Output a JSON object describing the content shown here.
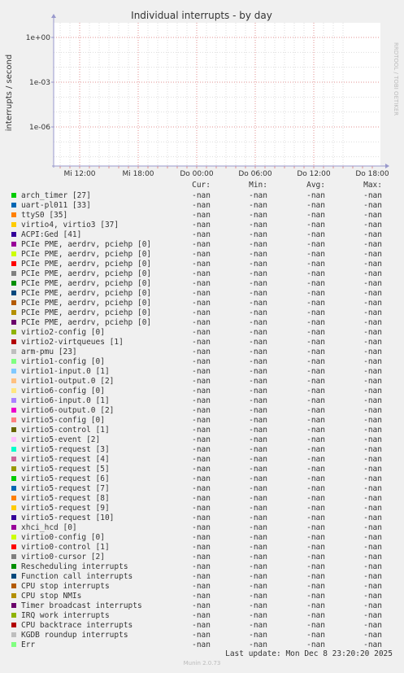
{
  "chart_data": {
    "type": "line",
    "title": "Individual interrupts - by day",
    "ylabel": "interrupts / second",
    "xlabel": "",
    "y_scale": "log",
    "y_ticks": [
      "1e+00",
      "1e-03",
      "1e-06"
    ],
    "x_ticks": [
      "Mi 12:00",
      "Mi 18:00",
      "Do 00:00",
      "Do 06:00",
      "Do 12:00",
      "Do 18:00"
    ],
    "watermark": "RRDTOOL / TOBI OETIKER",
    "grid": true,
    "columns": [
      "Cur:",
      "Min:",
      "Avg:",
      "Max:"
    ],
    "series": [
      {
        "name": "arch_timer [27]",
        "color": "#00cc00",
        "cur": "-nan",
        "min": "-nan",
        "avg": "-nan",
        "max": "-nan"
      },
      {
        "name": "uart-pl011 [33]",
        "color": "#0066b3",
        "cur": "-nan",
        "min": "-nan",
        "avg": "-nan",
        "max": "-nan"
      },
      {
        "name": "ttyS0 [35]",
        "color": "#ff8000",
        "cur": "-nan",
        "min": "-nan",
        "avg": "-nan",
        "max": "-nan"
      },
      {
        "name": "virtio4, virtio3 [37]",
        "color": "#ffcc00",
        "cur": "-nan",
        "min": "-nan",
        "avg": "-nan",
        "max": "-nan"
      },
      {
        "name": "ACPI:Ged [41]",
        "color": "#330099",
        "cur": "-nan",
        "min": "-nan",
        "avg": "-nan",
        "max": "-nan"
      },
      {
        "name": "PCIe PME, aerdrv, pciehp [0]",
        "color": "#990099",
        "cur": "-nan",
        "min": "-nan",
        "avg": "-nan",
        "max": "-nan"
      },
      {
        "name": "PCIe PME, aerdrv, pciehp [0]",
        "color": "#ccff00",
        "cur": "-nan",
        "min": "-nan",
        "avg": "-nan",
        "max": "-nan"
      },
      {
        "name": "PCIe PME, aerdrv, pciehp [0]",
        "color": "#ff0000",
        "cur": "-nan",
        "min": "-nan",
        "avg": "-nan",
        "max": "-nan"
      },
      {
        "name": "PCIe PME, aerdrv, pciehp [0]",
        "color": "#808080",
        "cur": "-nan",
        "min": "-nan",
        "avg": "-nan",
        "max": "-nan"
      },
      {
        "name": "PCIe PME, aerdrv, pciehp [0]",
        "color": "#008f00",
        "cur": "-nan",
        "min": "-nan",
        "avg": "-nan",
        "max": "-nan"
      },
      {
        "name": "PCIe PME, aerdrv, pciehp [0]",
        "color": "#00487d",
        "cur": "-nan",
        "min": "-nan",
        "avg": "-nan",
        "max": "-nan"
      },
      {
        "name": "PCIe PME, aerdrv, pciehp [0]",
        "color": "#b35a00",
        "cur": "-nan",
        "min": "-nan",
        "avg": "-nan",
        "max": "-nan"
      },
      {
        "name": "PCIe PME, aerdrv, pciehp [0]",
        "color": "#b38f00",
        "cur": "-nan",
        "min": "-nan",
        "avg": "-nan",
        "max": "-nan"
      },
      {
        "name": "PCIe PME, aerdrv, pciehp [0]",
        "color": "#6b006b",
        "cur": "-nan",
        "min": "-nan",
        "avg": "-nan",
        "max": "-nan"
      },
      {
        "name": "virtio2-config [0]",
        "color": "#8fb300",
        "cur": "-nan",
        "min": "-nan",
        "avg": "-nan",
        "max": "-nan"
      },
      {
        "name": "virtio2-virtqueues [1]",
        "color": "#b30000",
        "cur": "-nan",
        "min": "-nan",
        "avg": "-nan",
        "max": "-nan"
      },
      {
        "name": "arm-pmu [23]",
        "color": "#bebebe",
        "cur": "-nan",
        "min": "-nan",
        "avg": "-nan",
        "max": "-nan"
      },
      {
        "name": "virtio1-config [0]",
        "color": "#80ff80",
        "cur": "-nan",
        "min": "-nan",
        "avg": "-nan",
        "max": "-nan"
      },
      {
        "name": "virtio1-input.0 [1]",
        "color": "#80c9ff",
        "cur": "-nan",
        "min": "-nan",
        "avg": "-nan",
        "max": "-nan"
      },
      {
        "name": "virtio1-output.0 [2]",
        "color": "#ffc080",
        "cur": "-nan",
        "min": "-nan",
        "avg": "-nan",
        "max": "-nan"
      },
      {
        "name": "virtio6-config [0]",
        "color": "#ffe680",
        "cur": "-nan",
        "min": "-nan",
        "avg": "-nan",
        "max": "-nan"
      },
      {
        "name": "virtio6-input.0 [1]",
        "color": "#aa80ff",
        "cur": "-nan",
        "min": "-nan",
        "avg": "-nan",
        "max": "-nan"
      },
      {
        "name": "virtio6-output.0 [2]",
        "color": "#ee00cc",
        "cur": "-nan",
        "min": "-nan",
        "avg": "-nan",
        "max": "-nan"
      },
      {
        "name": "virtio5-config [0]",
        "color": "#ff8080",
        "cur": "-nan",
        "min": "-nan",
        "avg": "-nan",
        "max": "-nan"
      },
      {
        "name": "virtio5-control [1]",
        "color": "#666600",
        "cur": "-nan",
        "min": "-nan",
        "avg": "-nan",
        "max": "-nan"
      },
      {
        "name": "virtio5-event [2]",
        "color": "#ffbfff",
        "cur": "-nan",
        "min": "-nan",
        "avg": "-nan",
        "max": "-nan"
      },
      {
        "name": "virtio5-request [3]",
        "color": "#00ffcc",
        "cur": "-nan",
        "min": "-nan",
        "avg": "-nan",
        "max": "-nan"
      },
      {
        "name": "virtio5-request [4]",
        "color": "#cc6699",
        "cur": "-nan",
        "min": "-nan",
        "avg": "-nan",
        "max": "-nan"
      },
      {
        "name": "virtio5-request [5]",
        "color": "#999900",
        "cur": "-nan",
        "min": "-nan",
        "avg": "-nan",
        "max": "-nan"
      },
      {
        "name": "virtio5-request [6]",
        "color": "#00cc00",
        "cur": "-nan",
        "min": "-nan",
        "avg": "-nan",
        "max": "-nan"
      },
      {
        "name": "virtio5-request [7]",
        "color": "#0066b3",
        "cur": "-nan",
        "min": "-nan",
        "avg": "-nan",
        "max": "-nan"
      },
      {
        "name": "virtio5-request [8]",
        "color": "#ff8000",
        "cur": "-nan",
        "min": "-nan",
        "avg": "-nan",
        "max": "-nan"
      },
      {
        "name": "virtio5-request [9]",
        "color": "#ffcc00",
        "cur": "-nan",
        "min": "-nan",
        "avg": "-nan",
        "max": "-nan"
      },
      {
        "name": "virtio5-request [10]",
        "color": "#330099",
        "cur": "-nan",
        "min": "-nan",
        "avg": "-nan",
        "max": "-nan"
      },
      {
        "name": "xhci_hcd [0]",
        "color": "#990099",
        "cur": "-nan",
        "min": "-nan",
        "avg": "-nan",
        "max": "-nan"
      },
      {
        "name": "virtio0-config [0]",
        "color": "#ccff00",
        "cur": "-nan",
        "min": "-nan",
        "avg": "-nan",
        "max": "-nan"
      },
      {
        "name": "virtio0-control [1]",
        "color": "#ff0000",
        "cur": "-nan",
        "min": "-nan",
        "avg": "-nan",
        "max": "-nan"
      },
      {
        "name": "virtio0-cursor [2]",
        "color": "#808080",
        "cur": "-nan",
        "min": "-nan",
        "avg": "-nan",
        "max": "-nan"
      },
      {
        "name": "Rescheduling interrupts",
        "color": "#008f00",
        "cur": "-nan",
        "min": "-nan",
        "avg": "-nan",
        "max": "-nan"
      },
      {
        "name": "Function call interrupts",
        "color": "#00487d",
        "cur": "-nan",
        "min": "-nan",
        "avg": "-nan",
        "max": "-nan"
      },
      {
        "name": "CPU stop interrupts",
        "color": "#b35a00",
        "cur": "-nan",
        "min": "-nan",
        "avg": "-nan",
        "max": "-nan"
      },
      {
        "name": "CPU stop NMIs",
        "color": "#b38f00",
        "cur": "-nan",
        "min": "-nan",
        "avg": "-nan",
        "max": "-nan"
      },
      {
        "name": "Timer broadcast interrupts",
        "color": "#6b006b",
        "cur": "-nan",
        "min": "-nan",
        "avg": "-nan",
        "max": "-nan"
      },
      {
        "name": "IRQ work interrupts",
        "color": "#8fb300",
        "cur": "-nan",
        "min": "-nan",
        "avg": "-nan",
        "max": "-nan"
      },
      {
        "name": "CPU backtrace interrupts",
        "color": "#b30000",
        "cur": "-nan",
        "min": "-nan",
        "avg": "-nan",
        "max": "-nan"
      },
      {
        "name": "KGDB roundup interrupts",
        "color": "#bebebe",
        "cur": "-nan",
        "min": "-nan",
        "avg": "-nan",
        "max": "-nan"
      },
      {
        "name": "Err",
        "color": "#80ff80",
        "cur": "-nan",
        "min": "-nan",
        "avg": "-nan",
        "max": "-nan"
      }
    ]
  },
  "footer": {
    "last_update": "Last update: Mon Dec  8 23:20:20 2025",
    "munin": "Munin 2.0.73"
  }
}
